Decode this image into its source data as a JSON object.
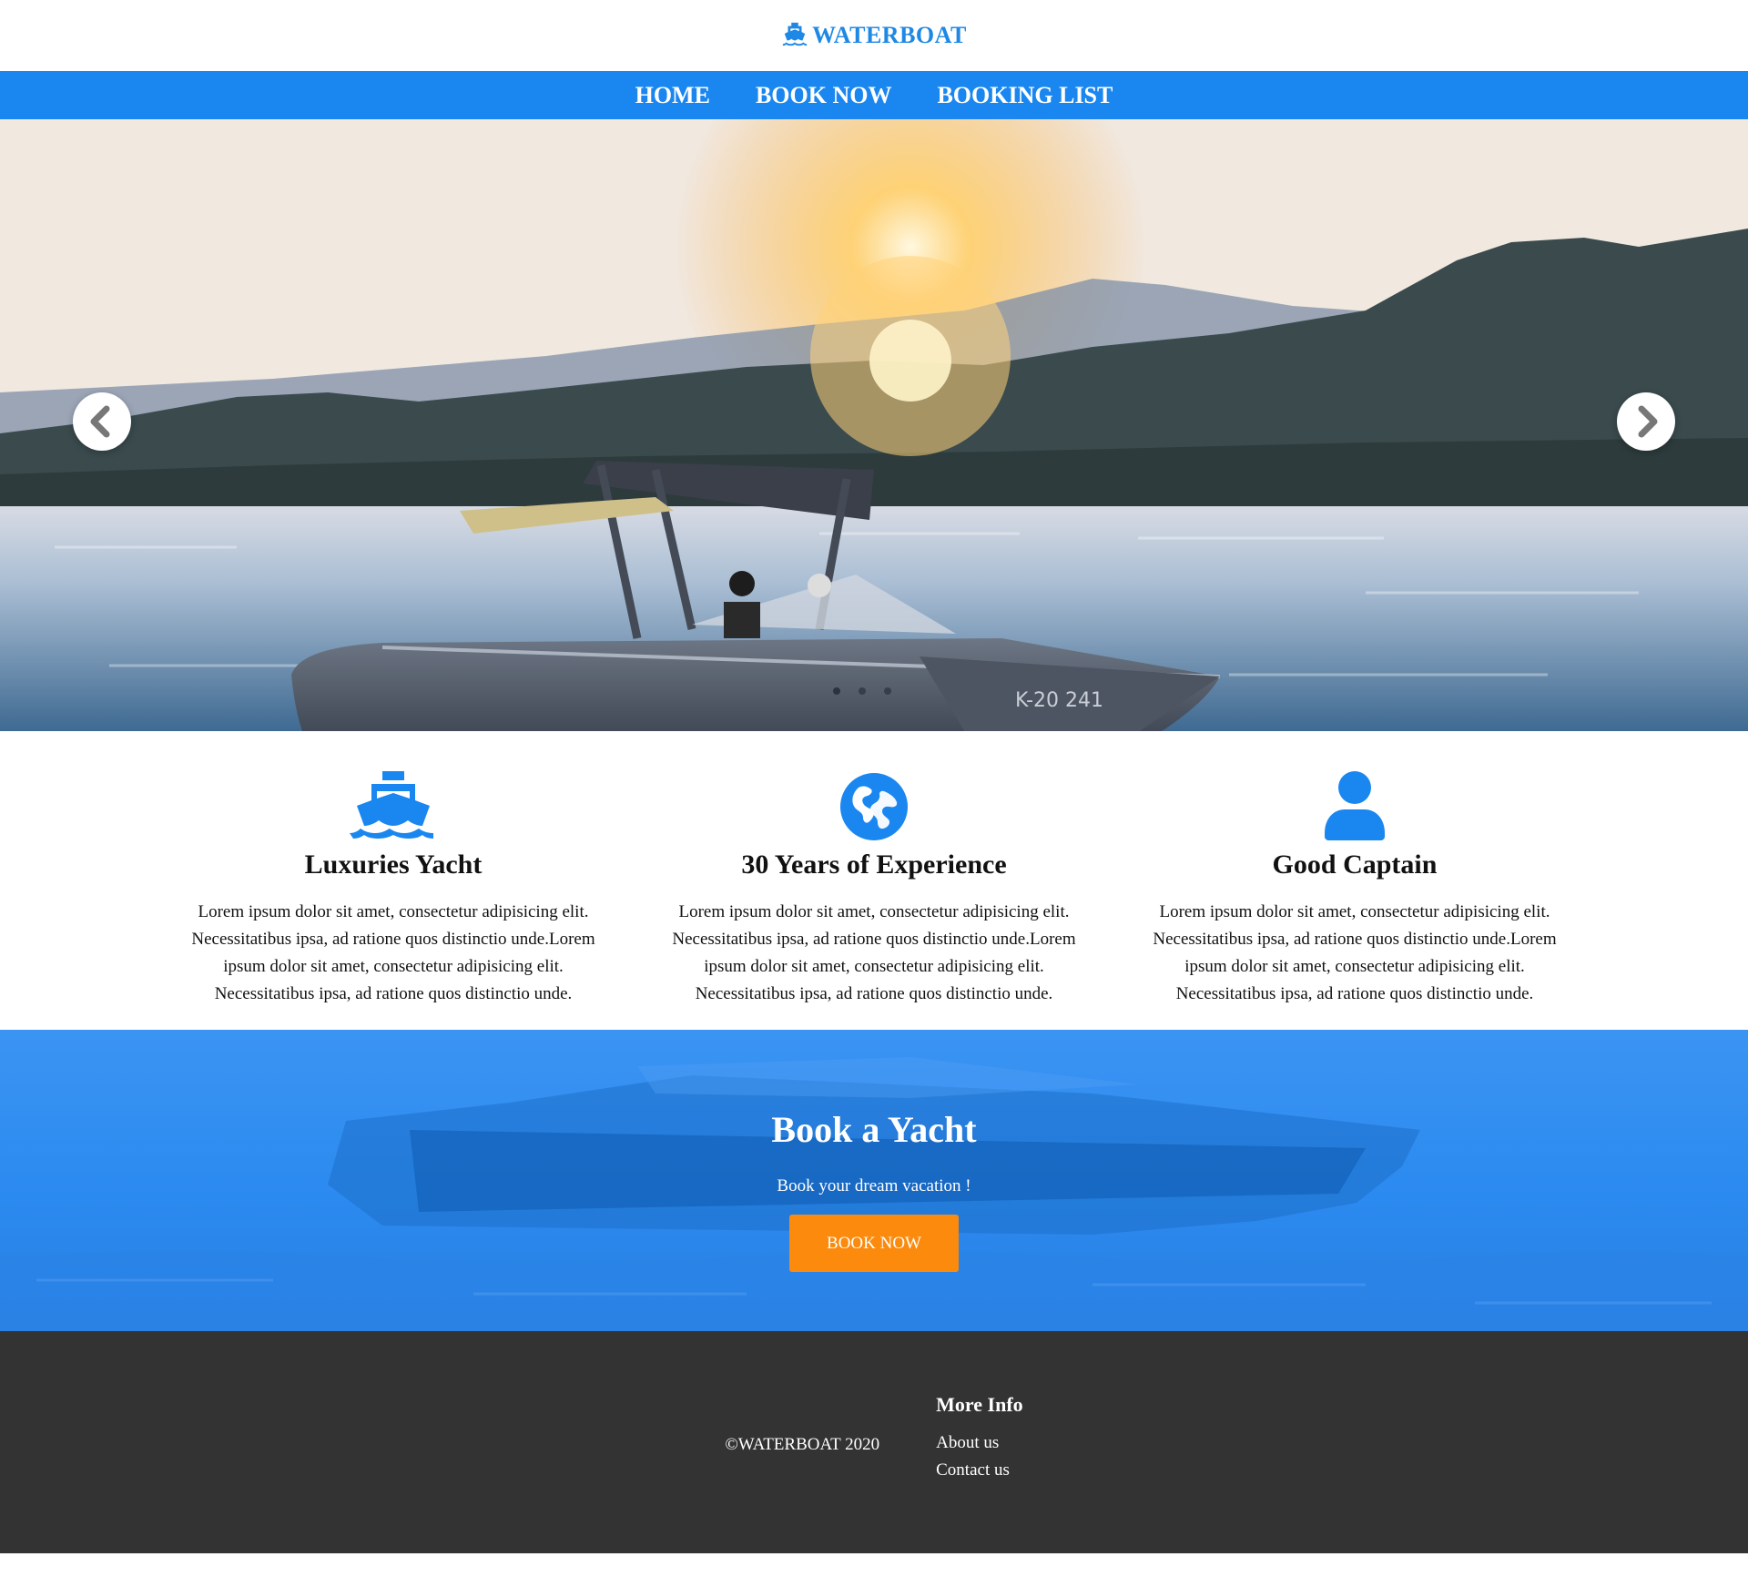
{
  "brand": {
    "name": "WATERBOAT",
    "icon": "ship-icon",
    "color": "#1e88e5"
  },
  "nav": {
    "items": [
      {
        "label": "HOME"
      },
      {
        "label": "BOOK NOW"
      },
      {
        "label": "BOOKING LIST"
      }
    ],
    "background": "#1a87f0"
  },
  "hero": {
    "slide_count": 3,
    "active_slide": 1,
    "boat_registration": "K-20 241",
    "prev_icon": "chevron-left-icon",
    "next_icon": "chevron-right-icon"
  },
  "features": [
    {
      "icon": "ship-icon",
      "title": "Luxuries Yacht",
      "text": "Lorem ipsum dolor sit amet, consectetur adipisicing elit. Necessitatibus ipsa, ad ratione quos distinctio unde.Lorem ipsum dolor sit amet, consectetur adipisicing elit. Necessitatibus ipsa, ad ratione quos distinctio unde."
    },
    {
      "icon": "globe-icon",
      "title": "30 Years of Experience",
      "text": "Lorem ipsum dolor sit amet, consectetur adipisicing elit. Necessitatibus ipsa, ad ratione quos distinctio unde.Lorem ipsum dolor sit amet, consectetur adipisicing elit. Necessitatibus ipsa, ad ratione quos distinctio unde."
    },
    {
      "icon": "user-icon",
      "title": "Good Captain",
      "text": "Lorem ipsum dolor sit amet, consectetur adipisicing elit. Necessitatibus ipsa, ad ratione quos distinctio unde.Lorem ipsum dolor sit amet, consectetur adipisicing elit. Necessitatibus ipsa, ad ratione quos distinctio unde."
    }
  ],
  "book": {
    "title": "Book a Yacht",
    "subtitle": "Book your dream vacation !",
    "button_label": "BOOK NOW",
    "button_color": "#fb8a0d"
  },
  "footer": {
    "copyright": "©WATERBOAT 2020",
    "more_info_title": "More Info",
    "links": [
      {
        "label": "About us"
      },
      {
        "label": "Contact us"
      }
    ],
    "background": "#333333"
  }
}
